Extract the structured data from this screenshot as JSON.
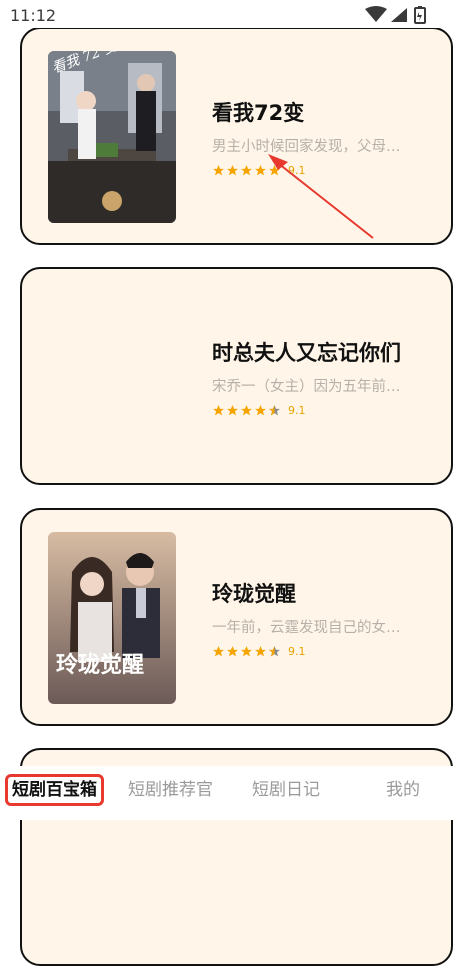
{
  "status_bar": {
    "time": "11:12",
    "icons": [
      "wifi-icon",
      "signal-icon",
      "battery-icon"
    ]
  },
  "dramas": [
    {
      "title": "看我72变",
      "description": "男主小时候回家发现，父母…",
      "rating": 9.1,
      "stars": 5,
      "poster": "poster-kan-wo-72-bian"
    },
    {
      "title": "时总夫人又忘记你们",
      "description": "宋乔一（女主）因为五年前…",
      "rating": 9.1,
      "stars": 4.5,
      "poster": ""
    },
    {
      "title": "玲珑觉醒",
      "description": "一年前，云霆发现自己的女…",
      "rating": 9.1,
      "stars": 4.5,
      "poster": "poster-ling-long-jue-xing"
    }
  ],
  "tabs": [
    {
      "label": "短剧百宝箱",
      "active": true
    },
    {
      "label": "短剧推荐官",
      "active": false
    },
    {
      "label": "短剧日记",
      "active": false
    },
    {
      "label": "我的",
      "active": false
    }
  ],
  "colors": {
    "card_bg": "#fff6e9",
    "star": "#f5a400",
    "star_gray": "#8a8a8a",
    "annotation": "#e8392e"
  },
  "poster_texts": {
    "first": "看我 72 变",
    "third": "玲珑觉醒"
  }
}
